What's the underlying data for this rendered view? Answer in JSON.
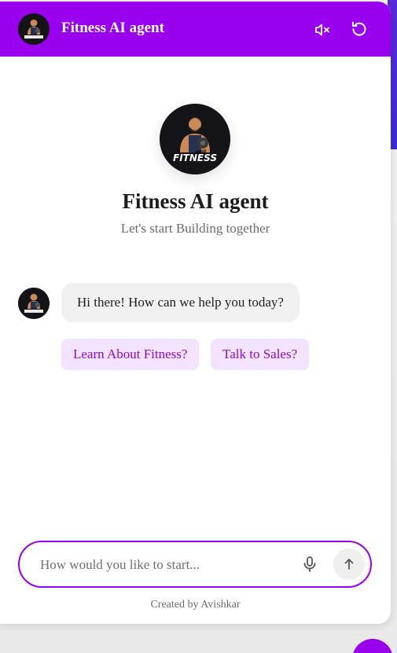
{
  "header": {
    "title": "Fitness AI agent",
    "logo_icon": "fitness-logo-icon",
    "mute_icon": "speaker-muted-icon",
    "reset_icon": "refresh-icon"
  },
  "hero": {
    "title": "Fitness AI agent",
    "subtitle": "Let's start Building together",
    "logo_text": "FITNESS"
  },
  "conversation": {
    "messages": [
      {
        "sender": "bot",
        "text": "Hi there! How can we help you today?"
      }
    ],
    "suggestions": [
      {
        "label": "Learn About Fitness?"
      },
      {
        "label": "Talk to Sales?"
      }
    ]
  },
  "composer": {
    "placeholder": "How would you like to start...",
    "value": "",
    "mic_icon": "microphone-icon",
    "send_icon": "arrow-up-icon"
  },
  "footer": {
    "credit": "Created by Avishkar"
  },
  "colors": {
    "accent": "#9900ee",
    "suggestion_bg": "#f4e3ff",
    "suggestion_text": "#8a0bd6",
    "bubble_bg": "#f1f1f1"
  }
}
